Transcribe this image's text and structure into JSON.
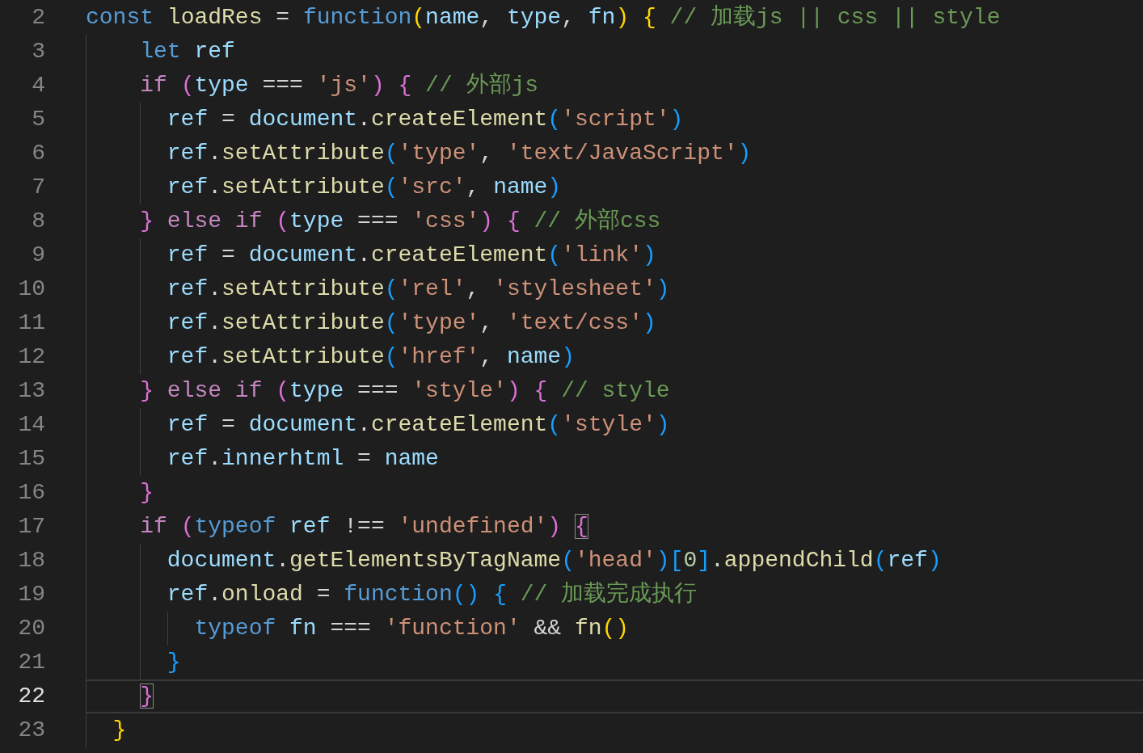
{
  "editor": {
    "lines": [
      {
        "number": "2",
        "current": false,
        "tokens": [
          {
            "kind": "keyword",
            "text": "const "
          },
          {
            "kind": "function",
            "text": "loadRes"
          },
          {
            "kind": "plain",
            "text": " = "
          },
          {
            "kind": "keyword",
            "text": "function"
          },
          {
            "kind": "bracket1",
            "text": "("
          },
          {
            "kind": "variable",
            "text": "name"
          },
          {
            "kind": "plain",
            "text": ", "
          },
          {
            "kind": "variable",
            "text": "type"
          },
          {
            "kind": "plain",
            "text": ", "
          },
          {
            "kind": "variable",
            "text": "fn"
          },
          {
            "kind": "bracket1",
            "text": ") "
          },
          {
            "kind": "bracket1",
            "text": "{ "
          },
          {
            "kind": "comment",
            "text": "// 加载js || css || style"
          }
        ]
      },
      {
        "number": "3",
        "current": false,
        "tokens": [
          {
            "kind": "keyword",
            "text": "    let "
          },
          {
            "kind": "variable",
            "text": "ref"
          }
        ]
      },
      {
        "number": "4",
        "current": false,
        "tokens": [
          {
            "kind": "control",
            "text": "    if "
          },
          {
            "kind": "bracket2",
            "text": "("
          },
          {
            "kind": "variable",
            "text": "type"
          },
          {
            "kind": "plain",
            "text": " === "
          },
          {
            "kind": "string",
            "text": "'js'"
          },
          {
            "kind": "bracket2",
            "text": ") "
          },
          {
            "kind": "bracket2",
            "text": "{ "
          },
          {
            "kind": "comment",
            "text": "// 外部js"
          }
        ]
      },
      {
        "number": "5",
        "current": false,
        "tokens": [
          {
            "kind": "variable",
            "text": "      ref"
          },
          {
            "kind": "plain",
            "text": " = "
          },
          {
            "kind": "variable",
            "text": "document"
          },
          {
            "kind": "plain",
            "text": "."
          },
          {
            "kind": "function",
            "text": "createElement"
          },
          {
            "kind": "bracket3",
            "text": "("
          },
          {
            "kind": "string",
            "text": "'script'"
          },
          {
            "kind": "bracket3",
            "text": ")"
          }
        ]
      },
      {
        "number": "6",
        "current": false,
        "tokens": [
          {
            "kind": "variable",
            "text": "      ref"
          },
          {
            "kind": "plain",
            "text": "."
          },
          {
            "kind": "function",
            "text": "setAttribute"
          },
          {
            "kind": "bracket3",
            "text": "("
          },
          {
            "kind": "string",
            "text": "'type'"
          },
          {
            "kind": "plain",
            "text": ", "
          },
          {
            "kind": "string",
            "text": "'text/JavaScript'"
          },
          {
            "kind": "bracket3",
            "text": ")"
          }
        ]
      },
      {
        "number": "7",
        "current": false,
        "tokens": [
          {
            "kind": "variable",
            "text": "      ref"
          },
          {
            "kind": "plain",
            "text": "."
          },
          {
            "kind": "function",
            "text": "setAttribute"
          },
          {
            "kind": "bracket3",
            "text": "("
          },
          {
            "kind": "string",
            "text": "'src'"
          },
          {
            "kind": "plain",
            "text": ", "
          },
          {
            "kind": "variable",
            "text": "name"
          },
          {
            "kind": "bracket3",
            "text": ")"
          }
        ]
      },
      {
        "number": "8",
        "current": false,
        "tokens": [
          {
            "kind": "bracket2",
            "text": "    } "
          },
          {
            "kind": "control",
            "text": "else if "
          },
          {
            "kind": "bracket2",
            "text": "("
          },
          {
            "kind": "variable",
            "text": "type"
          },
          {
            "kind": "plain",
            "text": " === "
          },
          {
            "kind": "string",
            "text": "'css'"
          },
          {
            "kind": "bracket2",
            "text": ") "
          },
          {
            "kind": "bracket2",
            "text": "{ "
          },
          {
            "kind": "comment",
            "text": "// 外部css"
          }
        ]
      },
      {
        "number": "9",
        "current": false,
        "tokens": [
          {
            "kind": "variable",
            "text": "      ref"
          },
          {
            "kind": "plain",
            "text": " = "
          },
          {
            "kind": "variable",
            "text": "document"
          },
          {
            "kind": "plain",
            "text": "."
          },
          {
            "kind": "function",
            "text": "createElement"
          },
          {
            "kind": "bracket3",
            "text": "("
          },
          {
            "kind": "string",
            "text": "'link'"
          },
          {
            "kind": "bracket3",
            "text": ")"
          }
        ]
      },
      {
        "number": "10",
        "current": false,
        "tokens": [
          {
            "kind": "variable",
            "text": "      ref"
          },
          {
            "kind": "plain",
            "text": "."
          },
          {
            "kind": "function",
            "text": "setAttribute"
          },
          {
            "kind": "bracket3",
            "text": "("
          },
          {
            "kind": "string",
            "text": "'rel'"
          },
          {
            "kind": "plain",
            "text": ", "
          },
          {
            "kind": "string",
            "text": "'stylesheet'"
          },
          {
            "kind": "bracket3",
            "text": ")"
          }
        ]
      },
      {
        "number": "11",
        "current": false,
        "tokens": [
          {
            "kind": "variable",
            "text": "      ref"
          },
          {
            "kind": "plain",
            "text": "."
          },
          {
            "kind": "function",
            "text": "setAttribute"
          },
          {
            "kind": "bracket3",
            "text": "("
          },
          {
            "kind": "string",
            "text": "'type'"
          },
          {
            "kind": "plain",
            "text": ", "
          },
          {
            "kind": "string",
            "text": "'text/css'"
          },
          {
            "kind": "bracket3",
            "text": ")"
          }
        ]
      },
      {
        "number": "12",
        "current": false,
        "tokens": [
          {
            "kind": "variable",
            "text": "      ref"
          },
          {
            "kind": "plain",
            "text": "."
          },
          {
            "kind": "function",
            "text": "setAttribute"
          },
          {
            "kind": "bracket3",
            "text": "("
          },
          {
            "kind": "string",
            "text": "'href'"
          },
          {
            "kind": "plain",
            "text": ", "
          },
          {
            "kind": "variable",
            "text": "name"
          },
          {
            "kind": "bracket3",
            "text": ")"
          }
        ]
      },
      {
        "number": "13",
        "current": false,
        "tokens": [
          {
            "kind": "bracket2",
            "text": "    } "
          },
          {
            "kind": "control",
            "text": "else if "
          },
          {
            "kind": "bracket2",
            "text": "("
          },
          {
            "kind": "variable",
            "text": "type"
          },
          {
            "kind": "plain",
            "text": " === "
          },
          {
            "kind": "string",
            "text": "'style'"
          },
          {
            "kind": "bracket2",
            "text": ") "
          },
          {
            "kind": "bracket2",
            "text": "{ "
          },
          {
            "kind": "comment",
            "text": "// style"
          }
        ]
      },
      {
        "number": "14",
        "current": false,
        "tokens": [
          {
            "kind": "variable",
            "text": "      ref"
          },
          {
            "kind": "plain",
            "text": " = "
          },
          {
            "kind": "variable",
            "text": "document"
          },
          {
            "kind": "plain",
            "text": "."
          },
          {
            "kind": "function",
            "text": "createElement"
          },
          {
            "kind": "bracket3",
            "text": "("
          },
          {
            "kind": "string",
            "text": "'style'"
          },
          {
            "kind": "bracket3",
            "text": ")"
          }
        ]
      },
      {
        "number": "15",
        "current": false,
        "tokens": [
          {
            "kind": "variable",
            "text": "      ref"
          },
          {
            "kind": "plain",
            "text": "."
          },
          {
            "kind": "variable",
            "text": "innerhtml"
          },
          {
            "kind": "plain",
            "text": " = "
          },
          {
            "kind": "variable",
            "text": "name"
          }
        ]
      },
      {
        "number": "16",
        "current": false,
        "tokens": [
          {
            "kind": "bracket2",
            "text": "    }"
          }
        ]
      },
      {
        "number": "17",
        "current": false,
        "tokens": [
          {
            "kind": "control",
            "text": "    if "
          },
          {
            "kind": "bracket2",
            "text": "("
          },
          {
            "kind": "keyword",
            "text": "typeof "
          },
          {
            "kind": "variable",
            "text": "ref"
          },
          {
            "kind": "plain",
            "text": " !== "
          },
          {
            "kind": "string",
            "text": "'undefined'"
          },
          {
            "kind": "bracket2",
            "text": ") "
          },
          {
            "kind": "matched",
            "text": "{"
          }
        ]
      },
      {
        "number": "18",
        "current": false,
        "tokens": [
          {
            "kind": "variable",
            "text": "      document"
          },
          {
            "kind": "plain",
            "text": "."
          },
          {
            "kind": "function",
            "text": "getElementsByTagName"
          },
          {
            "kind": "bracket3",
            "text": "("
          },
          {
            "kind": "string",
            "text": "'head'"
          },
          {
            "kind": "bracket3",
            "text": ")["
          },
          {
            "kind": "number",
            "text": "0"
          },
          {
            "kind": "bracket3",
            "text": "]"
          },
          {
            "kind": "plain",
            "text": "."
          },
          {
            "kind": "function",
            "text": "appendChild"
          },
          {
            "kind": "bracket3",
            "text": "("
          },
          {
            "kind": "variable",
            "text": "ref"
          },
          {
            "kind": "bracket3",
            "text": ")"
          }
        ]
      },
      {
        "number": "19",
        "current": false,
        "tokens": [
          {
            "kind": "variable",
            "text": "      ref"
          },
          {
            "kind": "plain",
            "text": "."
          },
          {
            "kind": "function",
            "text": "onload"
          },
          {
            "kind": "plain",
            "text": " = "
          },
          {
            "kind": "keyword",
            "text": "function"
          },
          {
            "kind": "bracket3",
            "text": "() "
          },
          {
            "kind": "bracket3",
            "text": "{ "
          },
          {
            "kind": "comment",
            "text": "// 加载完成执行"
          }
        ]
      },
      {
        "number": "20",
        "current": false,
        "tokens": [
          {
            "kind": "keyword",
            "text": "        typeof "
          },
          {
            "kind": "variable",
            "text": "fn"
          },
          {
            "kind": "plain",
            "text": " === "
          },
          {
            "kind": "string",
            "text": "'function'"
          },
          {
            "kind": "plain",
            "text": " && "
          },
          {
            "kind": "function",
            "text": "fn"
          },
          {
            "kind": "bracket1",
            "text": "()"
          }
        ]
      },
      {
        "number": "21",
        "current": false,
        "tokens": [
          {
            "kind": "bracket3",
            "text": "      }"
          }
        ]
      },
      {
        "number": "22",
        "current": true,
        "tokens": [
          {
            "kind": "matched",
            "text": "}"
          }
        ]
      },
      {
        "number": "23",
        "current": false,
        "tokens": [
          {
            "kind": "bracket1",
            "text": "  }"
          }
        ]
      }
    ]
  }
}
